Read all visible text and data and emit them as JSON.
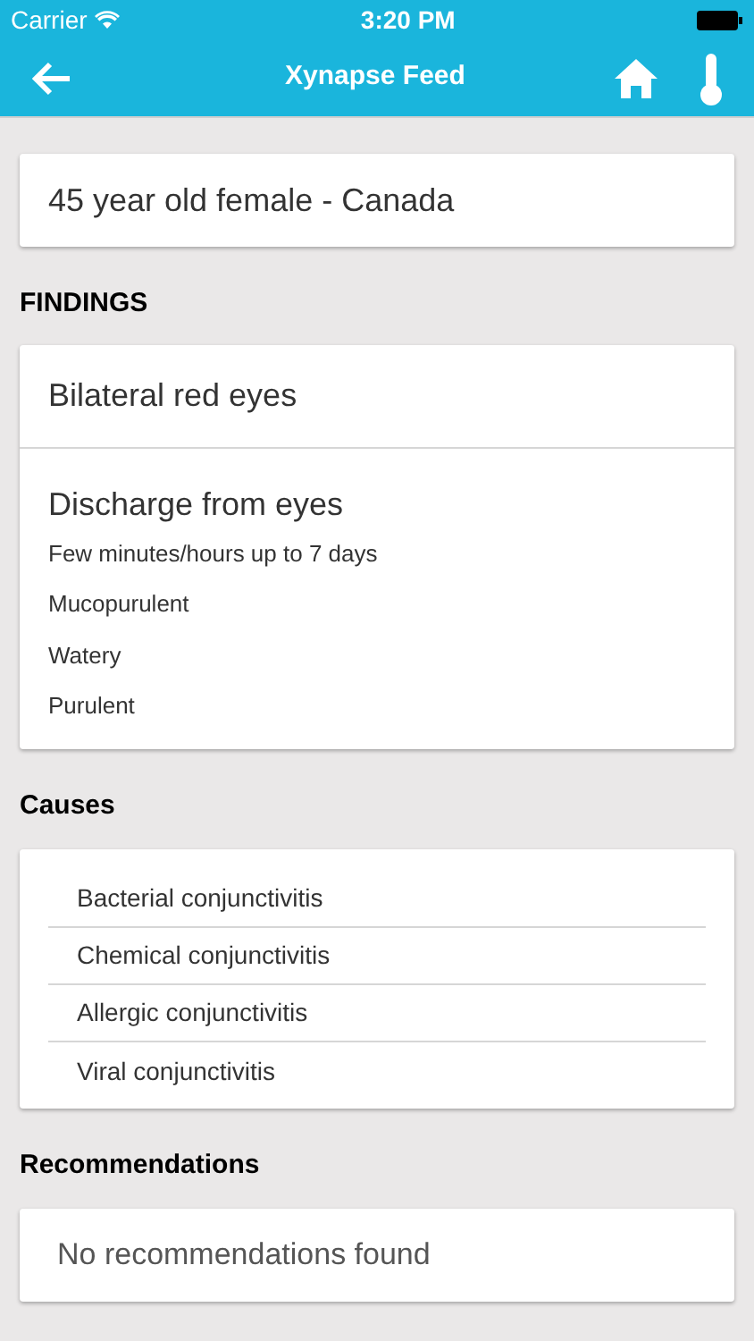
{
  "status_bar": {
    "carrier": "Carrier",
    "time": "3:20 PM"
  },
  "nav": {
    "title": "Xynapse Feed"
  },
  "patient": "45 year old female - Canada",
  "findings": {
    "heading": "FINDINGS",
    "items": [
      {
        "title": "Bilateral red eyes"
      },
      {
        "title": "Discharge from eyes",
        "details": [
          "Few minutes/hours up to 7 days",
          "Mucopurulent",
          "Watery",
          "Purulent"
        ]
      }
    ]
  },
  "causes": {
    "heading": "Causes",
    "items": [
      "Bacterial conjunctivitis",
      "Chemical conjunctivitis",
      "Allergic conjunctivitis",
      "Viral conjunctivitis"
    ]
  },
  "recommendations": {
    "heading": "Recommendations",
    "message": "No recommendations found"
  }
}
